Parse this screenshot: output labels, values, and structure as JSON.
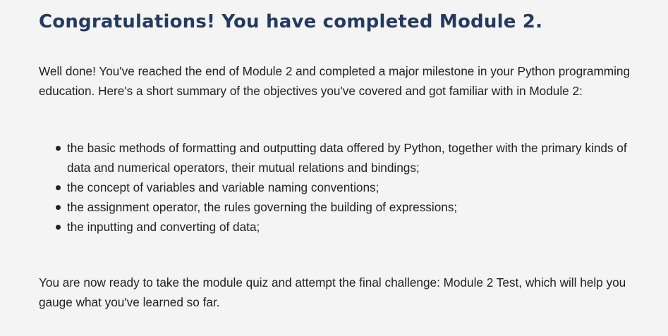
{
  "heading": "Congratulations! You have completed Module 2.",
  "intro": "Well done! You've reached the end of Module 2 and completed a major milestone in your Python programming education. Here's a short summary of the objectives you've covered and got familiar with in Module 2:",
  "objectives": [
    "the basic methods of formatting and outputting data offered by Python, together with the primary kinds of data and numerical operators, their mutual relations and bindings;",
    "the concept of variables and variable naming conventions;",
    "the assignment operator, the rules governing the building of expressions;",
    "the inputting and converting of data;"
  ],
  "outro": "You are now ready to take the module quiz and attempt the final challenge: Module 2 Test, which will help you gauge what you've learned so far.",
  "colors": {
    "heading": "#243a5e",
    "text": "#222222",
    "background": "#f4f4f4"
  }
}
